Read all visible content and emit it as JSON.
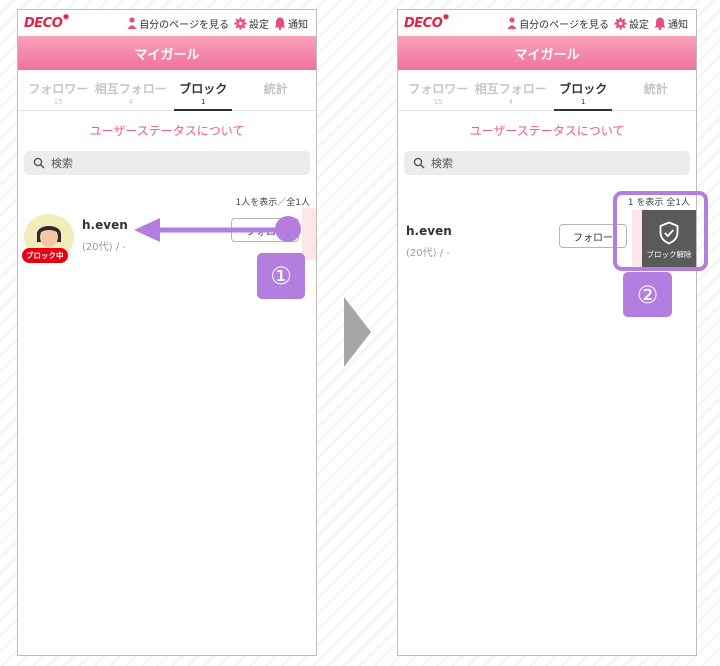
{
  "header": {
    "logo": "DECO",
    "mypage": "自分のページを見る",
    "settings": "設定",
    "notifications": "通知"
  },
  "title_bar": "マイガール",
  "tabs": [
    {
      "label": "フォロワー",
      "count": "15"
    },
    {
      "label": "相互フォロー",
      "count": "4"
    },
    {
      "label": "ブロック",
      "count": "1"
    },
    {
      "label": "統計",
      "count": ""
    }
  ],
  "status_link": "ユーザーステータスについて",
  "search": {
    "placeholder": "検索"
  },
  "count_text": "1人を表示／全1人",
  "count_text_partial": "1 を表示 全1人",
  "user": {
    "name": "h.even",
    "age": "(20代) / -",
    "badge": "ブロック中"
  },
  "follow_button": "フォロー",
  "follow_button_partial": "フォロ",
  "unblock_label": "ブロック解除",
  "steps": [
    "①",
    "②"
  ],
  "colors": {
    "accent": "#b37ee0",
    "header": "#f0729a",
    "brand": "#e62244"
  }
}
